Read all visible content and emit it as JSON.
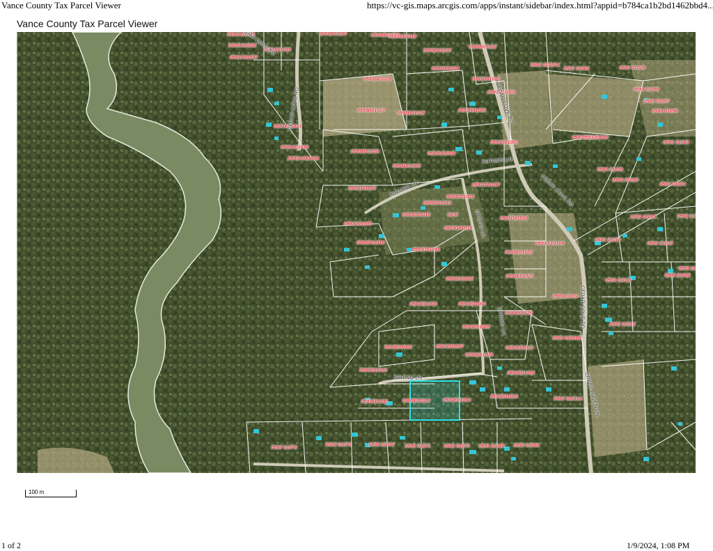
{
  "header": {
    "page_title": "Vance County Tax Parcel Viewer",
    "url": "https://vc-gis.maps.arcgis.com/apps/instant/sidebar/index.html?appid=b784ca1b2bd1462bbd4..."
  },
  "map": {
    "title": "Vance County Tax Parcel Viewer",
    "selected_parcel": "0593E01014",
    "colors": {
      "parcel_label": "#e0303a",
      "parcel_line": "#ffffff",
      "selection": "#2fe0e8",
      "structures": "#33c6d8",
      "water": "#7a8a62"
    },
    "parcel_labels": [
      "0593A01025",
      "0593B01018",
      "0593B01019",
      "0593A01030",
      "0593A01026",
      "0593A01029",
      "0593B01020",
      "0593B01002",
      "0593A01027",
      "0593B01021",
      "0593B01026",
      "0593B01022",
      "0593 01027A",
      "0593 01001",
      "0593 01025",
      "0593 01056",
      "0593 01057",
      "0593 01058",
      "0593B01001",
      "0593B01027",
      "0593B01023",
      "0593B01025",
      "0593A01033",
      "0593A01036",
      "0593D01001",
      "0593 01019",
      "0593 01020",
      "0593 01063",
      "0593B01028",
      "0593A01036A",
      "0593D01004",
      "0593D01005",
      "0593 01029",
      "0593 01015",
      "0593 01024",
      "0593D01007",
      "0593D01014",
      "0593D01017",
      "0593D01013",
      "0593D01012",
      "CEM",
      "0593D01009",
      "0593D01015",
      "0593D01024",
      "0593 01005",
      "0593 01052",
      "0593D01010",
      "0593D01016",
      "0593 01016A",
      "0593 01014",
      "0593 01023",
      "0593E01022",
      "0593E01002",
      "0593E01023",
      "0593 01013",
      "0593 01030",
      "0593 01032",
      "0593 01012",
      "0593E01003",
      "0593E01004",
      "0593E01020",
      "0593E01005",
      "0593 01018",
      "0593 01011B",
      "0593E01008",
      "0593E01007",
      "0593E01019",
      "0593E01009",
      "0593E01010",
      "0593E01018",
      "0593E01011",
      "0593E01013",
      "0593E01014",
      "0593E01016",
      "0593 01011A",
      "0593 01076",
      "0593 01073",
      "0593 01072",
      "0593 01071",
      "0593 01070",
      "0593 01069",
      "0593 01068"
    ],
    "road_labels": [
      "CEDAR COVE RD",
      "CEDAR COVE RD",
      "AUTUMN LN",
      "AUTUMN LN",
      "SPRING LN",
      "SPRING LN",
      "SPRING LN",
      "CEDAR COVE RD",
      "CEDAR COVE RD",
      "CEDAR COVE RD",
      "CRESS HAVEN LN"
    ],
    "scale_label": "100 m"
  },
  "footer": {
    "page_number": "1 of 2",
    "datetime": "1/9/2024, 1:08 PM"
  }
}
